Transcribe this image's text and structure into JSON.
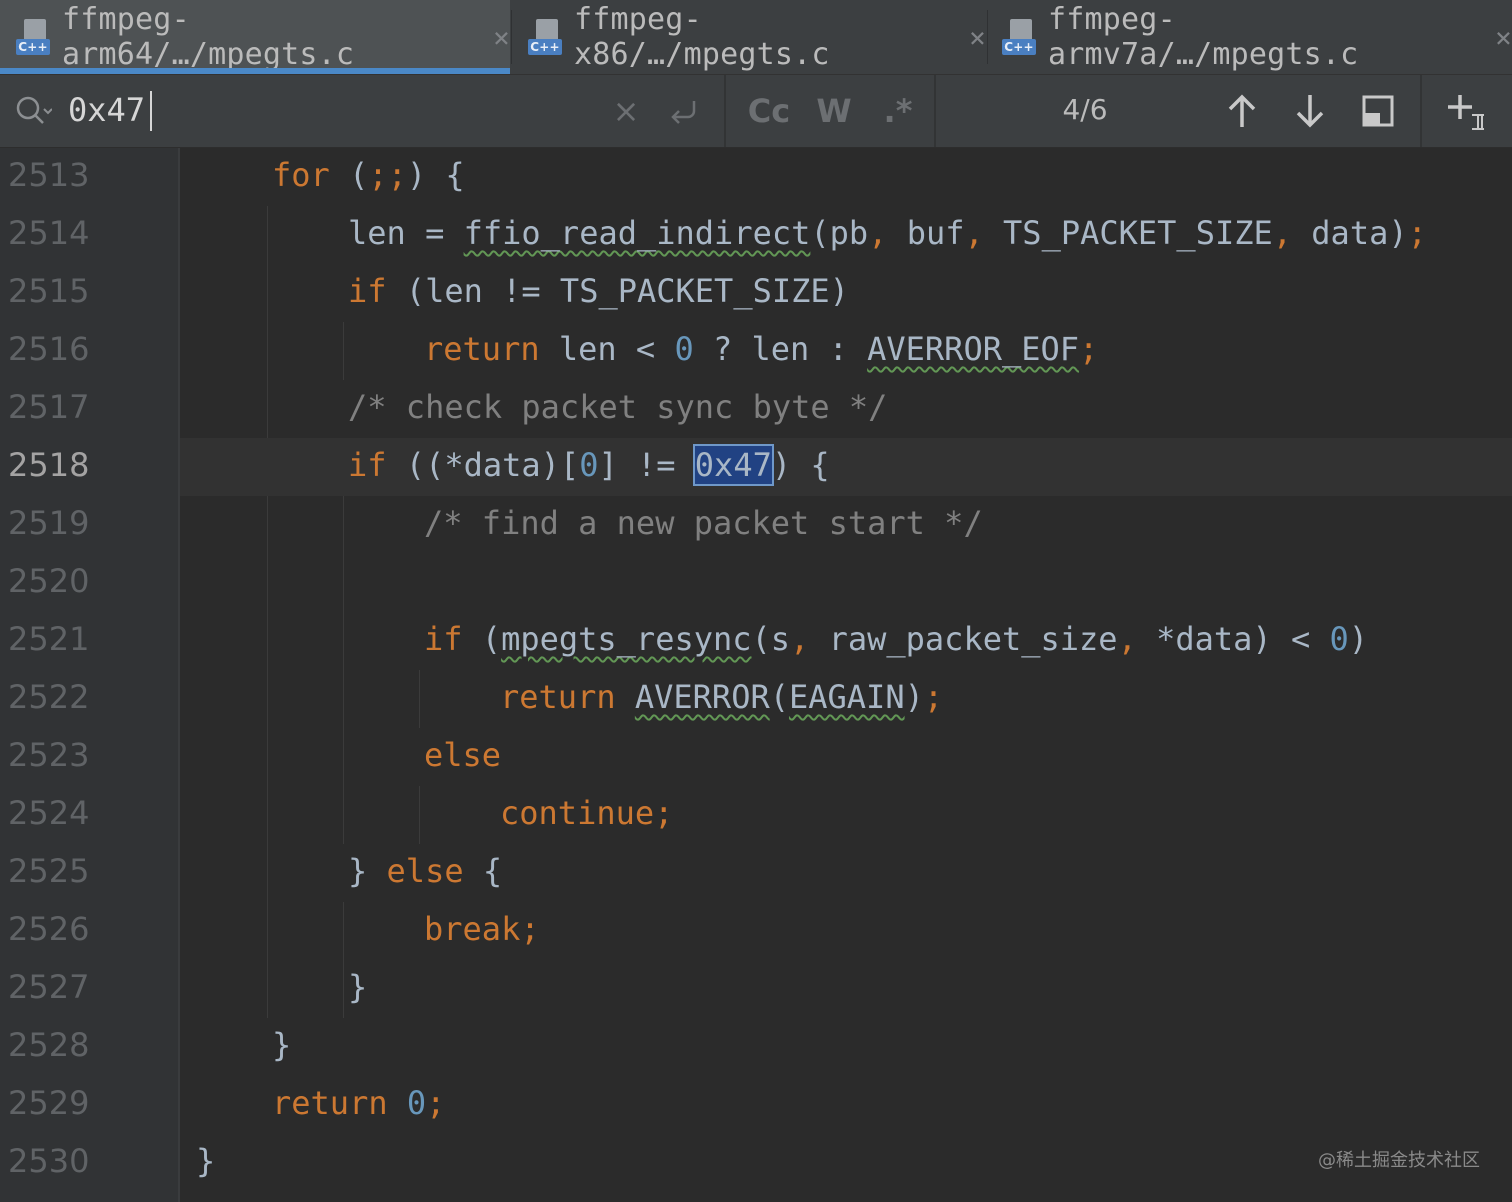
{
  "tabs": [
    {
      "label": "ffmpeg-arm64/…/mpegts.c",
      "icon": "cpp-file-icon",
      "active": true
    },
    {
      "label": "ffmpeg-x86/…/mpegts.c",
      "icon": "cpp-file-icon",
      "active": false
    },
    {
      "label": "ffmpeg-armv7a/…/mpegts.c",
      "icon": "cpp-file-icon",
      "active": false
    }
  ],
  "file_badge": "C++",
  "search": {
    "value": "0x47",
    "match_case_label": "Cc",
    "words_label": "W",
    "regex_label": ".*",
    "counter": "4/6"
  },
  "editor": {
    "current_line": "2518",
    "lines": [
      {
        "n": "2513"
      },
      {
        "n": "2514"
      },
      {
        "n": "2515"
      },
      {
        "n": "2516"
      },
      {
        "n": "2517"
      },
      {
        "n": "2518"
      },
      {
        "n": "2519"
      },
      {
        "n": "2520"
      },
      {
        "n": "2521"
      },
      {
        "n": "2522"
      },
      {
        "n": "2523"
      },
      {
        "n": "2524"
      },
      {
        "n": "2525"
      },
      {
        "n": "2526"
      },
      {
        "n": "2527"
      },
      {
        "n": "2528"
      },
      {
        "n": "2529"
      },
      {
        "n": "2530"
      }
    ],
    "code": {
      "l2513": [
        "for",
        " (",
        ";;",
        ") {"
      ],
      "l2514": [
        "len = ",
        "ffio_read_indirect",
        "(pb",
        ",",
        " buf",
        ",",
        " TS_PACKET_SIZE",
        ",",
        " data)",
        ";"
      ],
      "l2515": [
        "if",
        " (len != TS_PACKET_SIZE)"
      ],
      "l2516": [
        "return",
        " len < ",
        "0",
        " ? len : ",
        "AVERROR_EOF",
        ";"
      ],
      "l2517": [
        "/* check packet sync byte */"
      ],
      "l2518": [
        "if",
        " ((*data)[",
        "0",
        "] != ",
        "0x47",
        ") {"
      ],
      "l2519": [
        "/* find a new packet start */"
      ],
      "l2521": [
        "if",
        " (",
        "mpegts_resync",
        "(s",
        ",",
        " raw_packet_size",
        ",",
        " *data) < ",
        "0",
        ")"
      ],
      "l2522": [
        "return",
        " ",
        "AVERROR",
        "(",
        "EAGAIN",
        ")",
        ";"
      ],
      "l2523": [
        "else"
      ],
      "l2524": [
        "continue",
        ";"
      ],
      "l2525": [
        "} ",
        "else",
        " {"
      ],
      "l2526": [
        "break",
        ";"
      ],
      "l2527": [
        "}"
      ],
      "l2528": [
        "}"
      ],
      "l2529": [
        "return",
        " ",
        "0",
        ";"
      ],
      "l2530": [
        "}"
      ]
    }
  },
  "watermark": "@稀土掘金技术社区",
  "colors": {
    "keyword": "#cc7832",
    "number": "#6897bb",
    "comment": "#808080",
    "text": "#a9b7c6",
    "match_bg": "#214283",
    "tab_active_underline": "#4a88c7"
  }
}
